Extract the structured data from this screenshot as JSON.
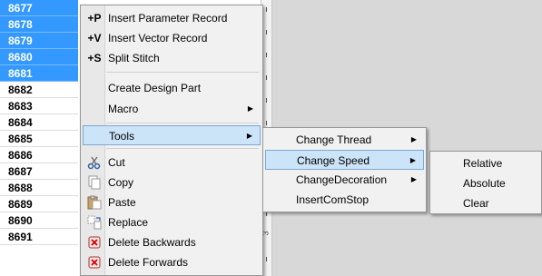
{
  "rows": [
    "8677",
    "8678",
    "8679",
    "8680",
    "8681",
    "8682",
    "8683",
    "8684",
    "8685",
    "8686",
    "8687",
    "8688",
    "8689",
    "8690",
    "8691"
  ],
  "selected_rows": [
    "8677",
    "8678",
    "8679",
    "8680",
    "8681"
  ],
  "ruler": {
    "label": "3"
  },
  "context_menu": {
    "items": [
      {
        "shortcut": "+P",
        "label": "Insert Parameter Record"
      },
      {
        "shortcut": "+V",
        "label": "Insert Vector Record"
      },
      {
        "shortcut": "+S",
        "label": "Split Stitch"
      },
      {
        "label": "Create Design Part"
      },
      {
        "label": "Macro",
        "submenu": true
      },
      {
        "label": "Tools",
        "submenu": true,
        "highlighted": true
      },
      {
        "label": "Cut",
        "icon": "scissors-icon"
      },
      {
        "label": "Copy",
        "icon": "copy-icon"
      },
      {
        "label": "Paste",
        "icon": "paste-icon"
      },
      {
        "label": "Replace",
        "icon": "replace-icon"
      },
      {
        "label": "Delete Backwards",
        "icon": "delete-backwards-icon"
      },
      {
        "label": "Delete Forwards",
        "icon": "delete-forwards-icon"
      }
    ]
  },
  "tools_submenu": {
    "items": [
      {
        "label": "Change Thread",
        "submenu": true
      },
      {
        "label": "Change Speed",
        "submenu": true,
        "highlighted": true
      },
      {
        "label": "ChangeDecoration",
        "submenu": true
      },
      {
        "label": "InsertComStop"
      }
    ]
  },
  "speed_submenu": {
    "items": [
      {
        "label": "Relative"
      },
      {
        "label": "Absolute"
      },
      {
        "label": "Clear"
      }
    ]
  },
  "colors": {
    "selection": "#3399ff",
    "menu_highlight": "#cce4f7",
    "menu_bg": "#f1f1f1",
    "panel": "#d8d8d8"
  }
}
